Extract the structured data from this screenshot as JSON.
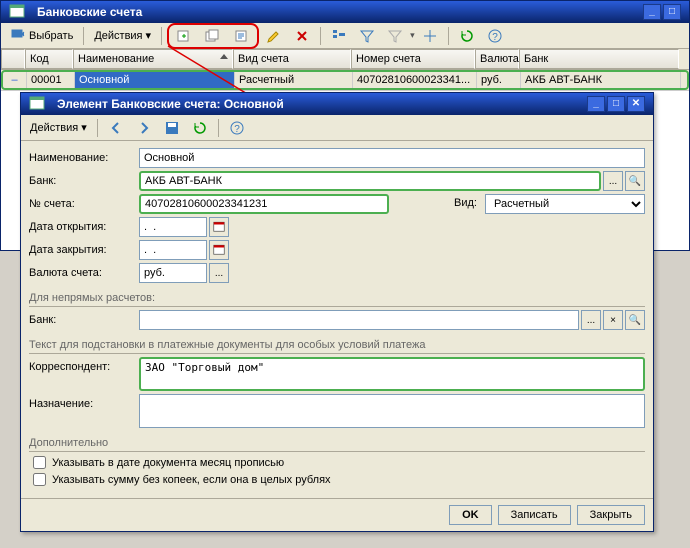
{
  "parent": {
    "title": "Банковские счета",
    "toolbar": {
      "select": "Выбрать",
      "actions": "Действия"
    },
    "grid": {
      "headers": {
        "code": "Код",
        "name": "Наименование",
        "type": "Вид счета",
        "account": "Номер счета",
        "currency": "Валюта",
        "bank": "Банк"
      },
      "row": {
        "marker": "–",
        "code": "00001",
        "name": "Основной",
        "type": "Расчетный",
        "account": "40702810600023341...",
        "currency": "руб.",
        "bank": "АКБ АВТ-БАНК"
      }
    }
  },
  "dialog": {
    "title": "Элемент Банковские счета: Основной",
    "toolbar": {
      "actions": "Действия"
    },
    "labels": {
      "name": "Наименование:",
      "bank": "Банк:",
      "account": "№ счета:",
      "type": "Вид:",
      "open_date": "Дата открытия:",
      "close_date": "Дата закрытия:",
      "currency": "Валюта счета:",
      "indirect_bank": "Банк:",
      "correspondent": "Корреспондент:",
      "purpose": "Назначение:"
    },
    "sections": {
      "indirect": "Для непрямых расчетов:",
      "subst": "Текст для подстановки в платежные документы для особых условий платежа",
      "additional": "Дополнительно"
    },
    "values": {
      "name": "Основной",
      "bank": "АКБ АВТ-БАНК",
      "account": "40702810600023341231",
      "type": "Расчетный",
      "open_date": ".  .",
      "close_date": ".  .",
      "currency": "руб.",
      "indirect_bank": "",
      "correspondent": "ЗАО \"Торговый дом\"",
      "purpose": ""
    },
    "checkboxes": {
      "month_words": "Указывать в дате документа месяц прописью",
      "no_kopecks": "Указывать сумму без копеек, если она в целых рублях"
    },
    "buttons": {
      "ok": "OK",
      "save": "Записать",
      "close": "Закрыть"
    }
  }
}
